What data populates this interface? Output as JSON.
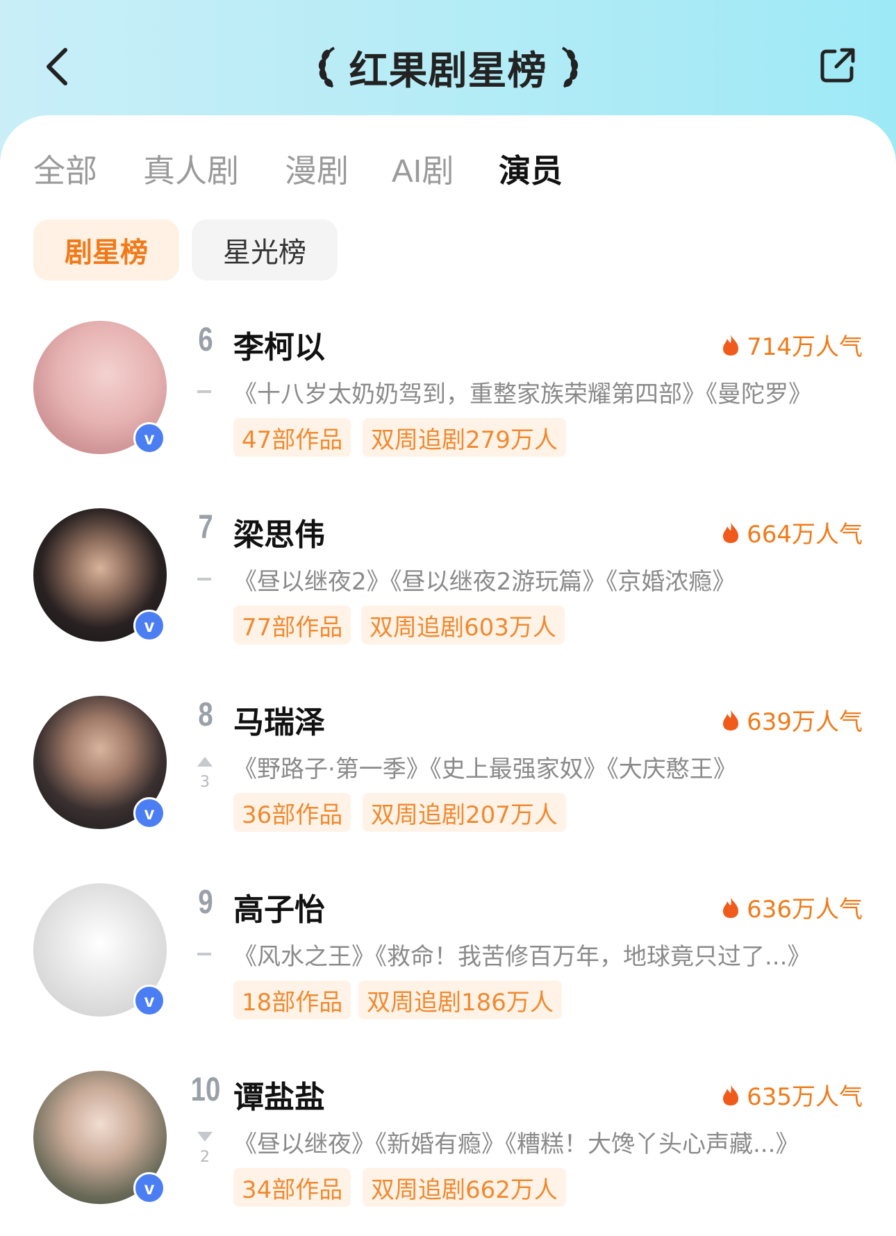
{
  "header": {
    "title": "红果剧星榜",
    "back_icon": "chevron-left-icon",
    "share_icon": "share-icon"
  },
  "tabs": [
    {
      "label": "全部",
      "active": false
    },
    {
      "label": "真人剧",
      "active": false
    },
    {
      "label": "漫剧",
      "active": false
    },
    {
      "label": "AI剧",
      "active": false
    },
    {
      "label": "演员",
      "active": true
    }
  ],
  "subtabs": [
    {
      "label": "剧星榜",
      "active": true
    },
    {
      "label": "星光榜",
      "active": false
    }
  ],
  "colors": {
    "accent": "#f07a19",
    "tag_bg": "#fff3e8",
    "verified": "#4b7ef2"
  },
  "verified_label": "v",
  "ranking": [
    {
      "rank": "6",
      "name": "李柯以",
      "popularity": "714万人气",
      "trend": "flat",
      "trend_num": "",
      "works": "《十八岁太奶奶驾到，重整家族荣耀第四部》《曼陀罗》",
      "tag_works": "47部作品",
      "tag_follow": "双周追剧279万人"
    },
    {
      "rank": "7",
      "name": "梁思伟",
      "popularity": "664万人气",
      "trend": "flat",
      "trend_num": "",
      "works": "《昼以继夜2》《昼以继夜2游玩篇》《京婚浓瘾》",
      "tag_works": "77部作品",
      "tag_follow": "双周追剧603万人"
    },
    {
      "rank": "8",
      "name": "马瑞泽",
      "popularity": "639万人气",
      "trend": "up",
      "trend_num": "3",
      "works": "《野路子·第一季》《史上最强家奴》《大庆憨王》",
      "tag_works": "36部作品",
      "tag_follow": "双周追剧207万人"
    },
    {
      "rank": "9",
      "name": "高子怡",
      "popularity": "636万人气",
      "trend": "flat",
      "trend_num": "",
      "works": "《风水之王》《救命！我苦修百万年，地球竟只过了...》",
      "tag_works": "18部作品",
      "tag_follow": "双周追剧186万人"
    },
    {
      "rank": "10",
      "name": "谭盐盐",
      "popularity": "635万人气",
      "trend": "down",
      "trend_num": "2",
      "works": "《昼以继夜》《新婚有瘾》《糟糕！大馋丫头心声藏...》",
      "tag_works": "34部作品",
      "tag_follow": "双周追剧662万人"
    }
  ]
}
